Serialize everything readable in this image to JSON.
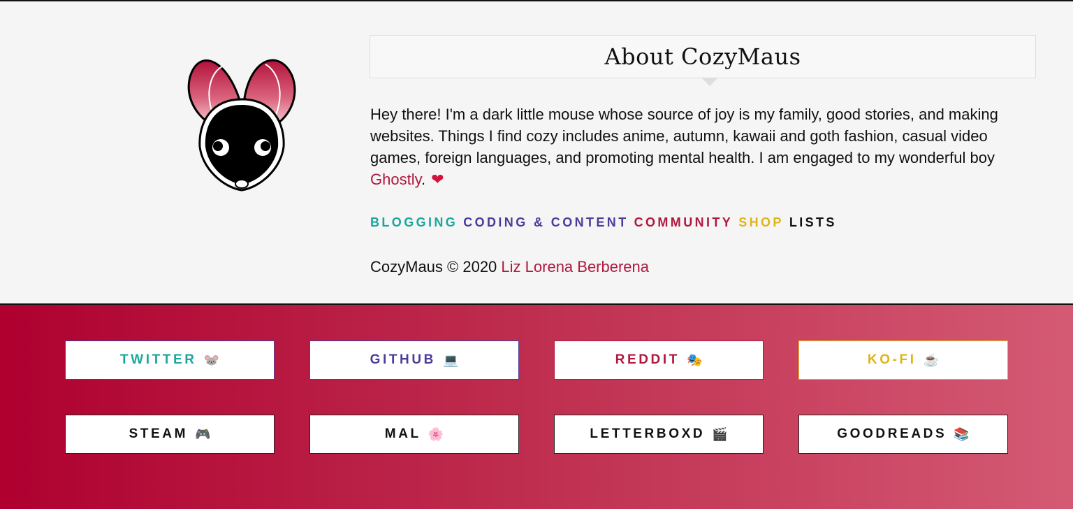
{
  "about": {
    "title": "About CozyMaus",
    "bio_text": "Hey there! I'm a dark little mouse whose source of joy is my family, good stories, and making websites. Things I find cozy includes anime, autumn, kawaii and goth fashion, casual video games, foreign languages, and promoting mental health. I am engaged to my wonderful boy ",
    "bio_link": "Ghostly",
    "bio_end": ".",
    "heart_icon": "❤"
  },
  "categories": [
    {
      "label": "BLOGGING",
      "color": "#1aa79b"
    },
    {
      "label": "CODING & CONTENT",
      "color": "#4a3d9a"
    },
    {
      "label": "COMMUNITY",
      "color": "#b0183e"
    },
    {
      "label": "SHOP",
      "color": "#e0b417"
    },
    {
      "label": "LISTS",
      "color": "#111111"
    }
  ],
  "credit": {
    "text": "CozyMaus © 2020 ",
    "author_link": "Liz Lorena Berberena"
  },
  "social": [
    {
      "label": "TWITTER",
      "icon": "🐭",
      "color": "#1aa79b",
      "border": "#4a3d9a"
    },
    {
      "label": "GITHUB",
      "icon": "💻",
      "color": "#4a3d9a",
      "border": "#4a3d9a"
    },
    {
      "label": "REDDIT",
      "icon": "🎭",
      "color": "#b0183e",
      "border": "#b0183e"
    },
    {
      "label": "KO-FI",
      "icon": "☕",
      "color": "#e0b417",
      "border": "#e0b417"
    },
    {
      "label": "STEAM",
      "icon": "🎮",
      "color": "#111111",
      "border": "#222222"
    },
    {
      "label": "MAL",
      "icon": "🌸",
      "color": "#111111",
      "border": "#222222"
    },
    {
      "label": "LETTERBOXD",
      "icon": "🎬",
      "color": "#111111",
      "border": "#222222"
    },
    {
      "label": "GOODREADS",
      "icon": "📚",
      "color": "#111111",
      "border": "#222222"
    }
  ]
}
